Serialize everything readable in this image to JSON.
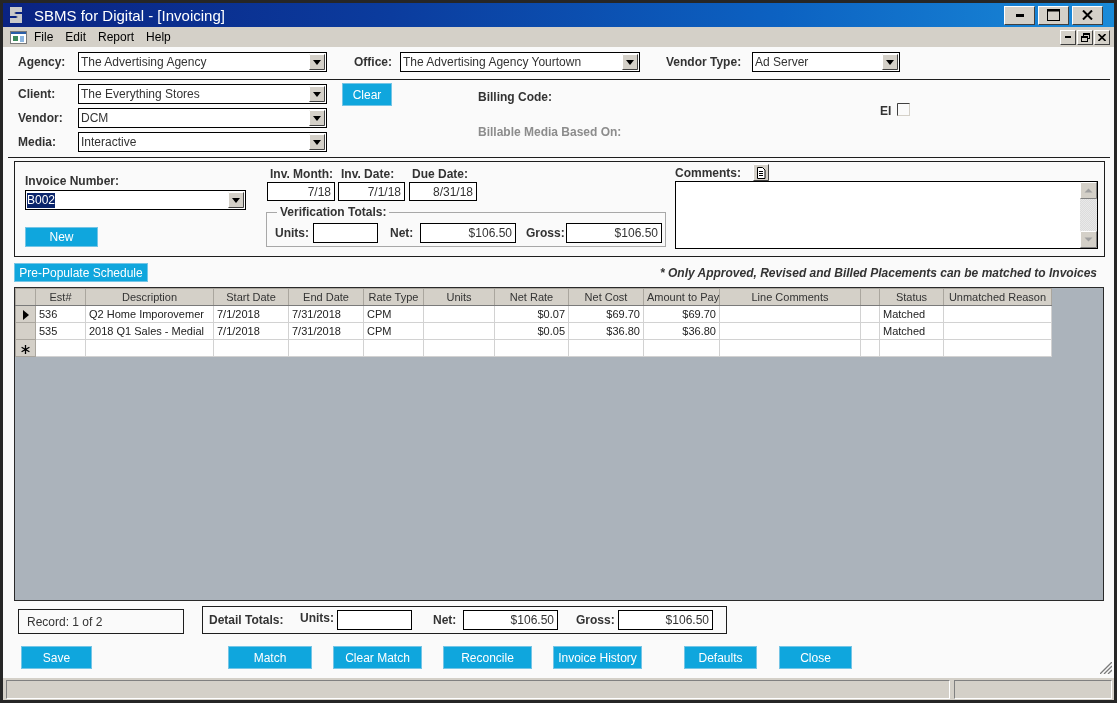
{
  "window": {
    "title": "SBMS for Digital - [Invoicing]"
  },
  "menu": [
    "File",
    "Edit",
    "Report",
    "Help"
  ],
  "header_filters": [
    {
      "label": "Agency:",
      "value": "The Advertising Agency"
    },
    {
      "label": "Office:",
      "value": "The Advertising Agency Yourtown"
    },
    {
      "label": "Vendor Type:",
      "value": "Ad Server"
    }
  ],
  "selection": {
    "fields": [
      {
        "label": "Client:",
        "value": "The Everything Stores"
      },
      {
        "label": "Vendor:",
        "value": "DCM"
      },
      {
        "label": "Media:",
        "value": "Interactive"
      }
    ],
    "clear_button": "Clear",
    "info_labels": [
      {
        "label": "Billing Code:",
        "disabled": false
      },
      {
        "label": "Billable Media Based On:",
        "disabled": true
      }
    ],
    "ei": {
      "label": "EI",
      "checked": false
    }
  },
  "invoice": {
    "number": {
      "label": "Invoice Number:",
      "value": "B002",
      "highlighted": true
    },
    "new_button": "New",
    "dates": [
      {
        "label": "Inv. Month:",
        "value": "7/18"
      },
      {
        "label": "Inv. Date:",
        "value": "7/1/18"
      },
      {
        "label": "Due Date:",
        "value": "8/31/18"
      }
    ],
    "verification_totals": {
      "title": "Verification Totals:",
      "fields": [
        {
          "label": "Units:"
        },
        {
          "label": "Net:",
          "value": "$106.50"
        },
        {
          "label": "Gross:",
          "value": "$106.50"
        }
      ]
    },
    "comments": {
      "label": "Comments:"
    }
  },
  "pre_populate_button": "Pre-Populate Schedule",
  "note": "* Only Approved, Revised and Billed Placements can be matched to Invoices",
  "table": {
    "columns": [
      {
        "label": "Est#",
        "kind": "text"
      },
      {
        "label": "Description",
        "kind": "text"
      },
      {
        "label": "Start Date",
        "kind": "text"
      },
      {
        "label": "End Date",
        "kind": "text"
      },
      {
        "label": "Rate Type",
        "kind": "text"
      },
      {
        "label": "Units",
        "kind": "amount"
      },
      {
        "label": "Net Rate",
        "kind": "amount"
      },
      {
        "label": "Net Cost",
        "kind": "amount"
      },
      {
        "label": "Amount to Pay",
        "kind": "amount"
      },
      {
        "label": "Line Comments",
        "kind": "text"
      },
      {
        "kind": "blank"
      },
      {
        "label": "Status",
        "kind": "text"
      },
      {
        "label": "Unmatched Reason",
        "kind": "text"
      }
    ],
    "rows": [
      {
        "selected": true,
        "est": "536",
        "description": "Q2 Home Imporovemer",
        "start_date": "7/1/2018",
        "end_date": "7/31/2018",
        "rate_type": "CPM",
        "net_rate": "$0.07",
        "net_cost": "$69.70",
        "amount_to_pay": "$69.70",
        "status": "Matched"
      },
      {
        "selected": false,
        "est": "535",
        "description": "2018 Q1 Sales - Medial",
        "start_date": "7/1/2018",
        "end_date": "7/31/2018",
        "rate_type": "CPM",
        "net_rate": "$0.05",
        "net_cost": "$36.80",
        "amount_to_pay": "$36.80",
        "status": "Matched"
      }
    ],
    "new_row": true
  },
  "record": "Record: 1 of 2",
  "detail_totals": {
    "title": "Detail Totals:",
    "fields": [
      {
        "label": "Units:"
      },
      {
        "label": "Net:",
        "value": "$106.50"
      },
      {
        "label": "Gross:",
        "value": "$106.50"
      }
    ]
  },
  "buttons": [
    "Save",
    "Match",
    "Clear Match",
    "Reconcile",
    "Invoice History",
    "Defaults",
    "Close"
  ]
}
